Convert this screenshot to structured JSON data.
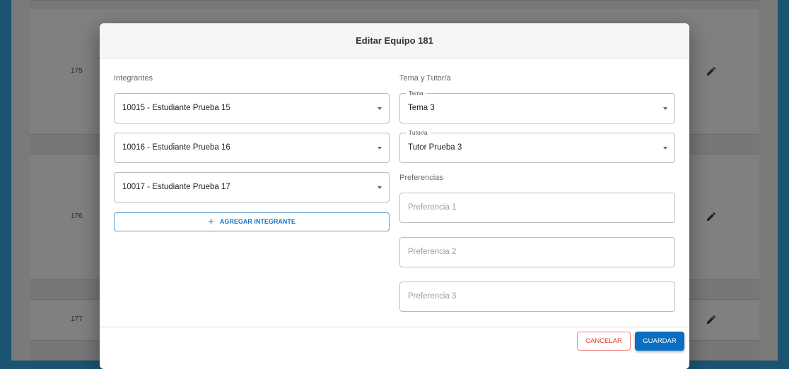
{
  "table": {
    "rows": [
      {
        "id": "175"
      },
      {
        "id": "176"
      },
      {
        "id": "177"
      }
    ]
  },
  "modal": {
    "title": "Editar Equipo 181",
    "members_label": "Integrantes",
    "members": [
      "10015 - Estudiante Prueba 15",
      "10016 - Estudiante Prueba 16",
      "10017 - Estudiante Prueba 17"
    ],
    "add_member": "AGREGAR INTEGRANTE",
    "topic_section": "Tema y Tutor/a",
    "topic": {
      "label": "Tema",
      "value": "Tema 3"
    },
    "tutor": {
      "label": "Tutor/a",
      "value": "Tutor Prueba 3"
    },
    "prefs_label": "Preferencias",
    "prefs": [
      {
        "placeholder": "Preferencia 1"
      },
      {
        "placeholder": "Preferencia 2"
      },
      {
        "placeholder": "Preferencia 3"
      }
    ],
    "cancel": "CANCELAR",
    "save": "GUARDAR"
  },
  "colors": {
    "primary": "#0a6fc2",
    "danger": "#e53935"
  }
}
